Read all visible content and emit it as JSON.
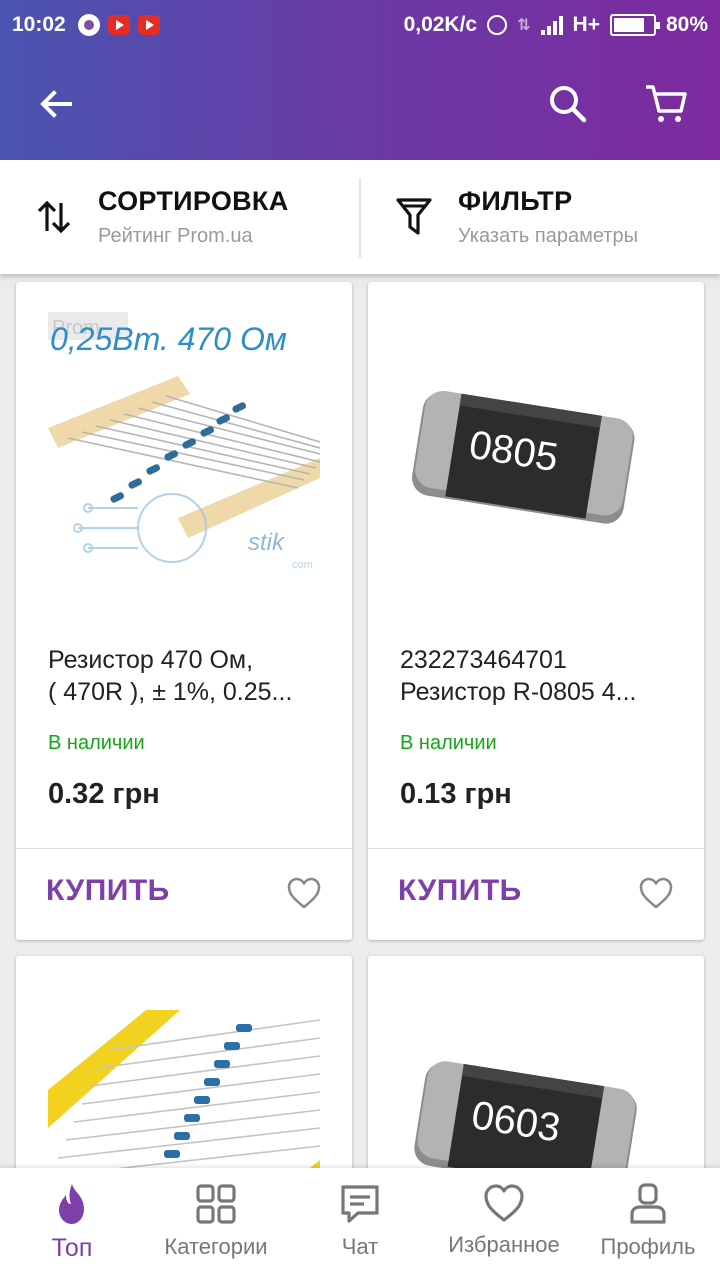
{
  "status_bar": {
    "time": "10:02",
    "speed": "0,02K/c",
    "network": "H+",
    "battery": "80%",
    "battery_level": 0.8
  },
  "toolbar": {
    "back_icon": "arrow-left-icon",
    "search_icon": "search-icon",
    "cart_icon": "cart-icon"
  },
  "sort": {
    "title": "СОРТИРОВКА",
    "subtitle": "Рейтинг Prom.ua",
    "icon": "sort-arrows-icon"
  },
  "filter": {
    "title": "ФИЛЬТР",
    "subtitle": "Указать параметры",
    "icon": "filter-funnel-icon"
  },
  "products": [
    {
      "image_text": "0,25Вт.   470 Ом",
      "image_watermark": "Prom",
      "image_logo": "stik",
      "image_logo_small": "com",
      "title_line1": "Резистор 470 Ом,",
      "title_line2": "( 470R ), ± 1%, 0.25...",
      "stock": "В наличии",
      "price": "0.32 грн",
      "buy_label": "КУПИТЬ"
    },
    {
      "image_text": "0805",
      "title_line1": "232273464701",
      "title_line2": "Резистор R-0805 4...",
      "stock": "В наличии",
      "price": "0.13 грн",
      "buy_label": "КУПИТЬ"
    },
    {
      "title_line1": "",
      "title_line2": ""
    },
    {
      "image_text": "0603"
    }
  ],
  "bottom_nav": [
    {
      "label": "Топ",
      "icon": "flame-icon",
      "active": true
    },
    {
      "label": "Категории",
      "icon": "grid-icon",
      "active": false
    },
    {
      "label": "Чат",
      "icon": "chat-icon",
      "active": false
    },
    {
      "label": "Избранное",
      "icon": "heart-icon",
      "active": false
    },
    {
      "label": "Профиль",
      "icon": "profile-icon",
      "active": false
    }
  ],
  "colors": {
    "accent": "#7d3fa8",
    "in_stock": "#17a317",
    "header_start": "#4a55b0",
    "header_end": "#7d2a9e"
  }
}
